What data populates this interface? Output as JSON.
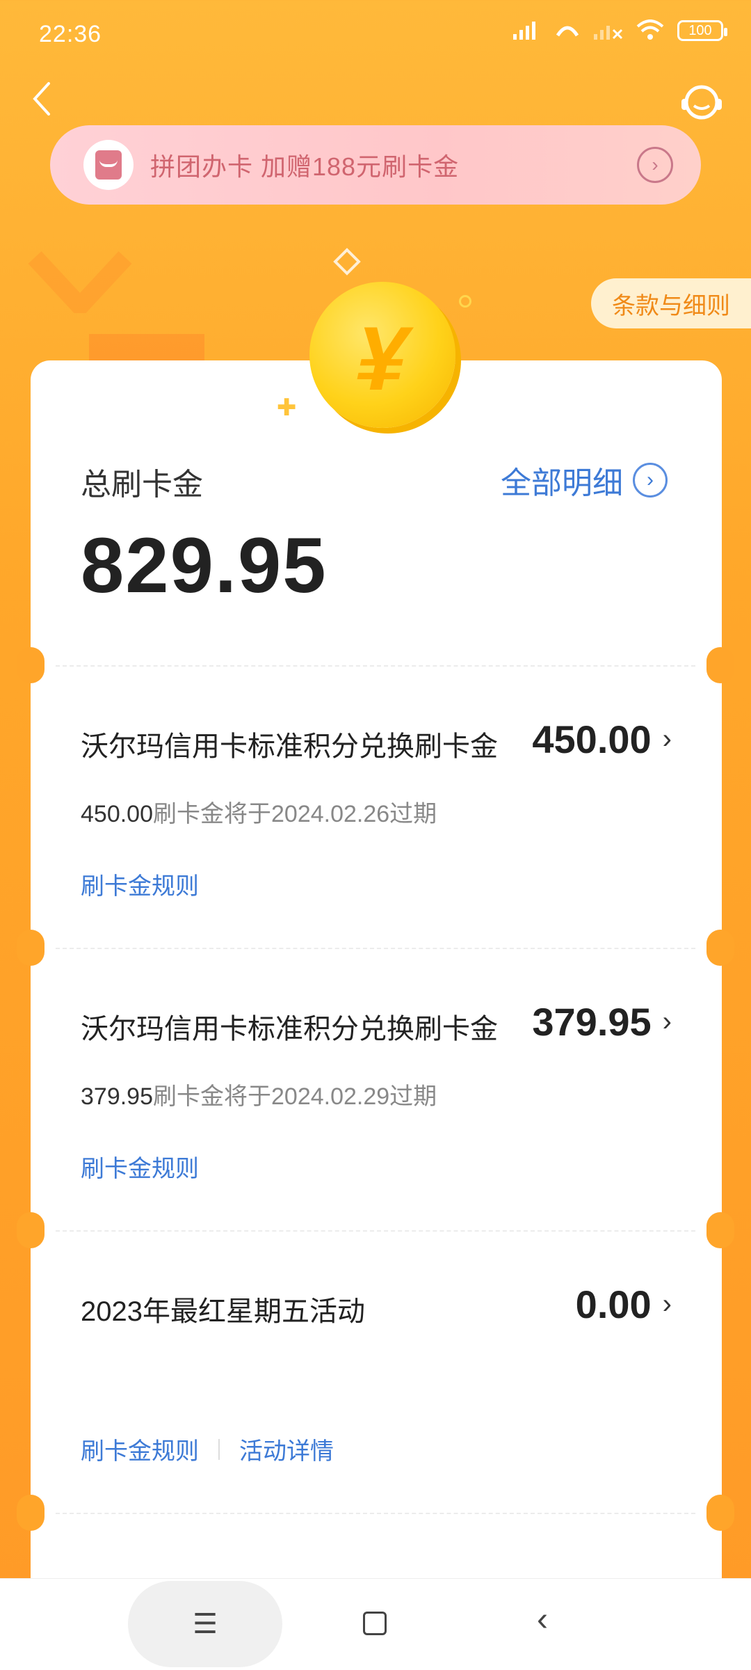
{
  "status_bar": {
    "time": "22:36",
    "battery": "100"
  },
  "header": {
    "back_icon": "back-chevron-icon",
    "service_icon": "customer-service-icon"
  },
  "banner": {
    "text": "拼团办卡 加赠188元刷卡金",
    "arrow": "›"
  },
  "terms_button": "条款与细则",
  "summary": {
    "label": "总刷卡金",
    "value": "829.95",
    "detail_link": "全部明细",
    "detail_arrow": "›"
  },
  "items": [
    {
      "title": "沃尔玛信用卡标准积分兑换刷卡金",
      "amount": "450.00",
      "expiry_amount": "450.00",
      "expiry_text": "刷卡金将于2024.02.26过期",
      "links": [
        "刷卡金规则"
      ]
    },
    {
      "title": "沃尔玛信用卡标准积分兑换刷卡金",
      "amount": "379.95",
      "expiry_amount": "379.95",
      "expiry_text": "刷卡金将于2024.02.29过期",
      "links": [
        "刷卡金规则"
      ]
    },
    {
      "title": "2023年最红星期五活动",
      "amount": "0.00",
      "links": [
        "刷卡金规则",
        "活动详情"
      ]
    }
  ],
  "chevron": "›",
  "nav": {
    "menu": "☰",
    "back": "‹"
  },
  "colors": {
    "accent_blue": "#3d7ad6",
    "background_orange": "#ffa52a",
    "banner_pink": "#ffc7c9"
  }
}
